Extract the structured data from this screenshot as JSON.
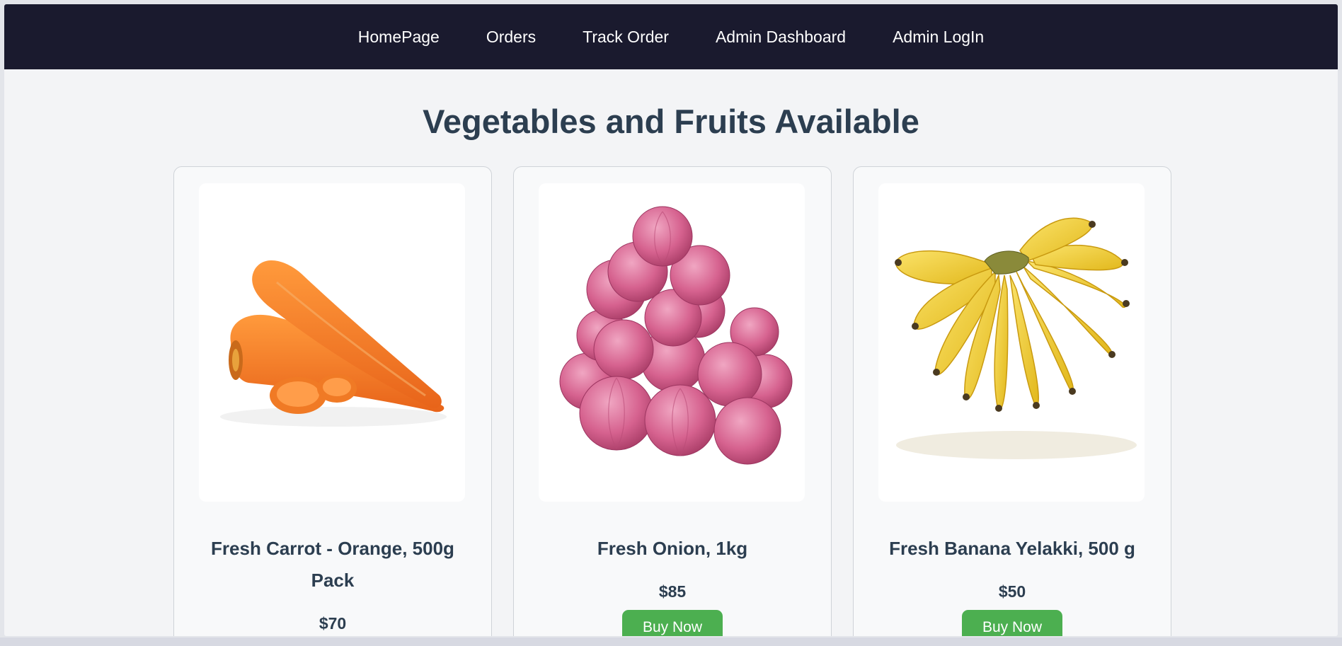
{
  "nav": {
    "items": [
      {
        "label": "HomePage"
      },
      {
        "label": "Orders"
      },
      {
        "label": "Track Order"
      },
      {
        "label": "Admin Dashboard"
      },
      {
        "label": "Admin LogIn"
      }
    ],
    "background": "#1a1a2e"
  },
  "page": {
    "title": "Vegetables and Fruits Available"
  },
  "products": [
    {
      "name": "Fresh Carrot - Orange, 500g Pack",
      "price": "$70",
      "image": "carrot-image"
    },
    {
      "name": "Fresh Onion, 1kg",
      "price": "$85",
      "image": "onion-image",
      "button_label": "Buy Now"
    },
    {
      "name": "Fresh Banana Yelakki, 500 g",
      "price": "$50",
      "image": "banana-image",
      "button_label": "Buy Now"
    }
  ],
  "colors": {
    "accent": "#4caf50",
    "heading": "#2c3e50",
    "page_bg": "#f3f4f6"
  }
}
